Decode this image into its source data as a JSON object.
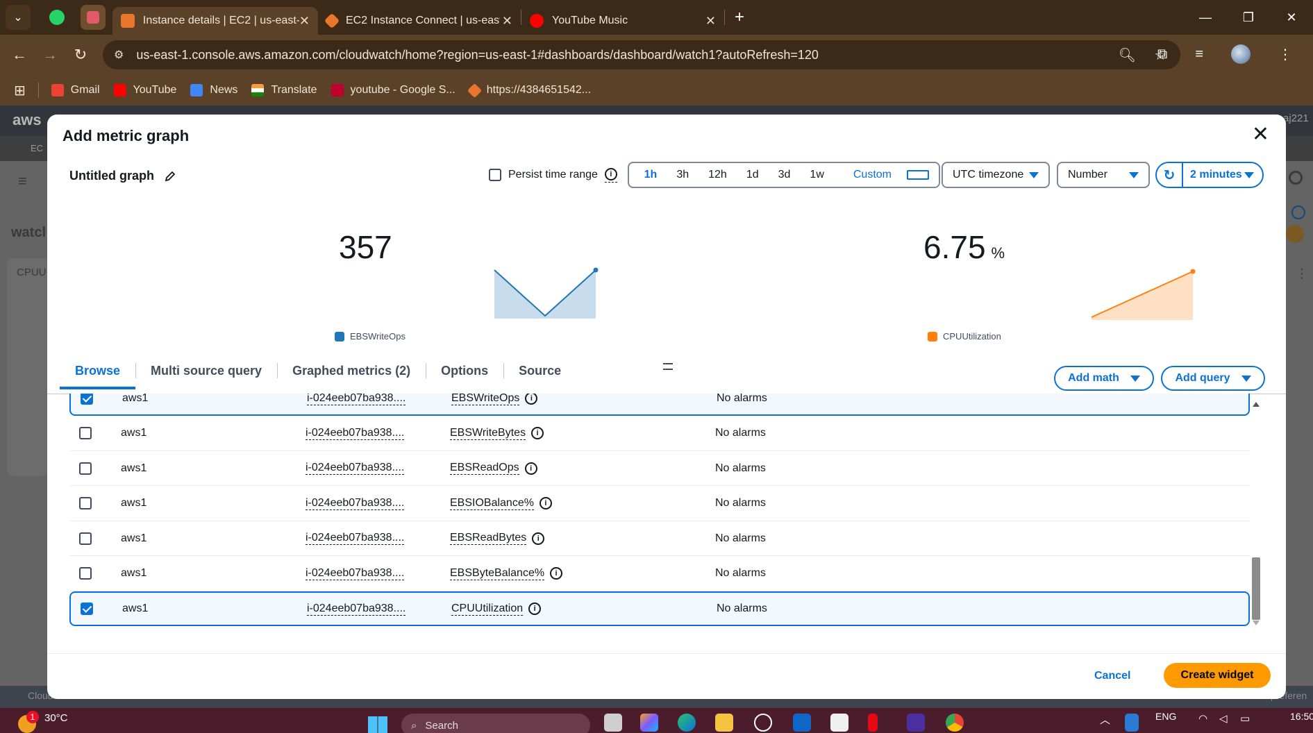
{
  "browser": {
    "tabs": [
      {
        "label": "Instance details | EC2 | us-east-",
        "color": "#e8762d"
      },
      {
        "label": "EC2 Instance Connect | us-east-",
        "color": "#e8762d"
      },
      {
        "label": "YouTube Music",
        "color": "#ff0000"
      }
    ],
    "url": "us-east-1.console.aws.amazon.com/cloudwatch/home?region=us-east-1#dashboards/dashboard/watch1?autoRefresh=120",
    "bookmarks": [
      {
        "label": "Gmail",
        "color": "#ea4335"
      },
      {
        "label": "YouTube",
        "color": "#ff0000"
      },
      {
        "label": "News",
        "color": "#4285f4"
      },
      {
        "label": "Translate",
        "color": "#ff9933"
      },
      {
        "label": "youtube - Google S...",
        "color": "#c2002f"
      },
      {
        "label": "https://4384651542...",
        "color": "#e8762d"
      }
    ]
  },
  "console": {
    "logo": "aws",
    "ec2_crumb": "EC",
    "page_title_partial": "watcl",
    "card_partial": "CPUU",
    "account_partial": "aj221",
    "bottom_left": "Cloud",
    "bottom_right": "preferen"
  },
  "modal": {
    "title": "Add metric graph",
    "graph_title": "Untitled graph",
    "persist_label": "Persist time range",
    "ranges": [
      "1h",
      "3h",
      "12h",
      "1d",
      "3d",
      "1w"
    ],
    "selected_range": "1h",
    "custom_label": "Custom",
    "timezone": "UTC timezone",
    "display": "Number",
    "refresh": "2 minutes",
    "widgets": [
      {
        "value": "357",
        "unit": "",
        "metric": "EBSWriteOps",
        "color": "#1f77b4",
        "fill": "#c7dced",
        "trend": [
          3,
          1,
          3
        ]
      },
      {
        "value": "6.75",
        "unit": "%",
        "metric": "CPUUtilization",
        "color": "#ff7f0e",
        "fill": "#ffe0c4",
        "trend": [
          0,
          1
        ]
      }
    ],
    "tabs": [
      "Browse",
      "Multi source query",
      "Graphed metrics (2)",
      "Options",
      "Source"
    ],
    "active_tab": "Browse",
    "add_math": "Add math",
    "add_query": "Add query",
    "rows": [
      {
        "account": "aws1",
        "instance": "i-024eeb07ba938....",
        "metric": "EBSWriteOps",
        "alarms": "No alarms",
        "checked": true
      },
      {
        "account": "aws1",
        "instance": "i-024eeb07ba938....",
        "metric": "EBSWriteBytes",
        "alarms": "No alarms",
        "checked": false
      },
      {
        "account": "aws1",
        "instance": "i-024eeb07ba938....",
        "metric": "EBSReadOps",
        "alarms": "No alarms",
        "checked": false
      },
      {
        "account": "aws1",
        "instance": "i-024eeb07ba938....",
        "metric": "EBSIOBalance%",
        "alarms": "No alarms",
        "checked": false
      },
      {
        "account": "aws1",
        "instance": "i-024eeb07ba938....",
        "metric": "EBSReadBytes",
        "alarms": "No alarms",
        "checked": false
      },
      {
        "account": "aws1",
        "instance": "i-024eeb07ba938....",
        "metric": "EBSByteBalance%",
        "alarms": "No alarms",
        "checked": false
      },
      {
        "account": "aws1",
        "instance": "i-024eeb07ba938....",
        "metric": "CPUUtilization",
        "alarms": "No alarms",
        "checked": true
      }
    ],
    "cancel": "Cancel",
    "create": "Create widget"
  },
  "taskbar": {
    "weather": "30°C",
    "search": "Search",
    "lang": "ENG",
    "time": "16:50",
    "badge": "1"
  }
}
